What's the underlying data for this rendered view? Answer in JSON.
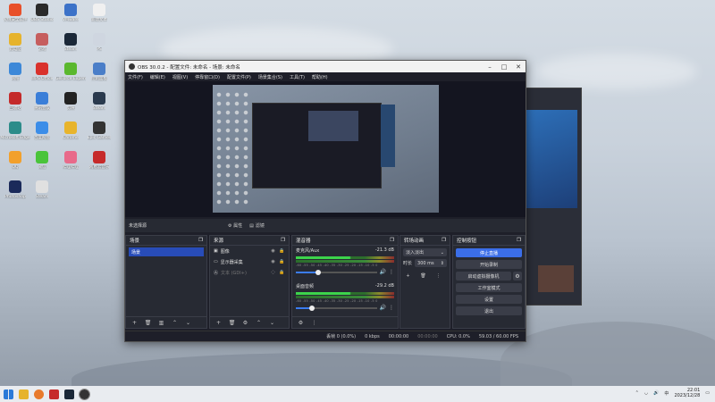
{
  "desktop": {
    "icons": [
      {
        "label": "火绒安全软件",
        "color": "#e8502a"
      },
      {
        "label": "OBS Studio",
        "color": "#2a2a2a"
      },
      {
        "label": "VMware",
        "color": "#3c72c8"
      },
      {
        "label": "新建文本",
        "color": "#f0f0f0"
      },
      {
        "label": "此电脑",
        "color": "#e6b32c"
      },
      {
        "label": "游戏",
        "color": "#c65e5e"
      },
      {
        "label": "Steam",
        "color": "#1b2838"
      },
      {
        "label": "PS",
        "color": "#cfd6e0"
      },
      {
        "label": "网络",
        "color": "#3c88d8"
      },
      {
        "label": "WPS Office",
        "color": "#d9322c"
      },
      {
        "label": "GeForce Experience",
        "color": "#5ab82e"
      },
      {
        "label": "控制面板",
        "color": "#4a7ec8"
      },
      {
        "label": "回收站",
        "color": "#c42a2a"
      },
      {
        "label": "腾讯会议",
        "color": "#3a7ed8"
      },
      {
        "label": "剪映",
        "color": "#222222"
      },
      {
        "label": "Steam",
        "color": "#2a3a4e"
      },
      {
        "label": "Microsoft Edge",
        "color": "#2c8c8a"
      },
      {
        "label": "百度网盘",
        "color": "#3b8de8"
      },
      {
        "label": "Chrome",
        "color": "#e8b42c"
      },
      {
        "label": "Epic Games",
        "color": "#333333"
      },
      {
        "label": "QQ",
        "color": "#f2a02c"
      },
      {
        "label": "微信",
        "color": "#4ac43a"
      },
      {
        "label": "哔哩哔哩",
        "color": "#e86a8a"
      },
      {
        "label": "网易云音乐",
        "color": "#c62a2a"
      },
      {
        "label": "Photoshop",
        "color": "#1b2a5a"
      },
      {
        "label": "Steam",
        "color": "#e0e0e0"
      }
    ]
  },
  "obs": {
    "title": "OBS 30.0.2 - 配置文件: 未命名 - 场景: 未命名",
    "menu": [
      "文件(F)",
      "编辑(E)",
      "视图(V)",
      "停靠窗口(D)",
      "配置文件(P)",
      "场景集合(S)",
      "工具(T)",
      "帮助(H)"
    ],
    "source_bar": {
      "no_source": "未选择源",
      "properties": "⚙ 属性",
      "filters": "滤镜"
    },
    "scenes": {
      "title": "场景",
      "items": [
        "场景"
      ]
    },
    "sources": {
      "title": "来源",
      "items": [
        {
          "name": "图像",
          "enabled": true
        },
        {
          "name": "显示器采集",
          "enabled": true
        },
        {
          "name": "文本 (GDI+)",
          "enabled": false
        }
      ]
    },
    "mixer": {
      "title": "混音器",
      "channels": [
        {
          "name": "麦克风/Aux",
          "db": "-21.3 dB",
          "level": 0.28
        },
        {
          "name": "桌面音频",
          "db": "-29.2 dB",
          "level": 0.2
        }
      ],
      "scale": "-60 -55 -50 -45 -40 -35 -30 -25 -20 -15 -10 -5 0"
    },
    "transitions": {
      "title": "转场动画",
      "type": "淡入淡出",
      "duration_label": "时长",
      "duration": "300 ms"
    },
    "controls": {
      "title": "控制按钮",
      "buttons": [
        "停止直播",
        "开始录制",
        "启动虚拟摄像机",
        "工作室模式",
        "设置",
        "退出"
      ]
    },
    "status": {
      "dropped": "丢帧 0 (0.0%)",
      "kbps": "0 kbps",
      "stream_time": "00:00:00",
      "rec_time": "00:00:00",
      "cpu": "CPU: 0.0%",
      "fps": "59.03 / 60.00 FPS"
    }
  },
  "taskbar": {
    "time": "22:01",
    "date": "2023/12/28",
    "lang": "中"
  }
}
